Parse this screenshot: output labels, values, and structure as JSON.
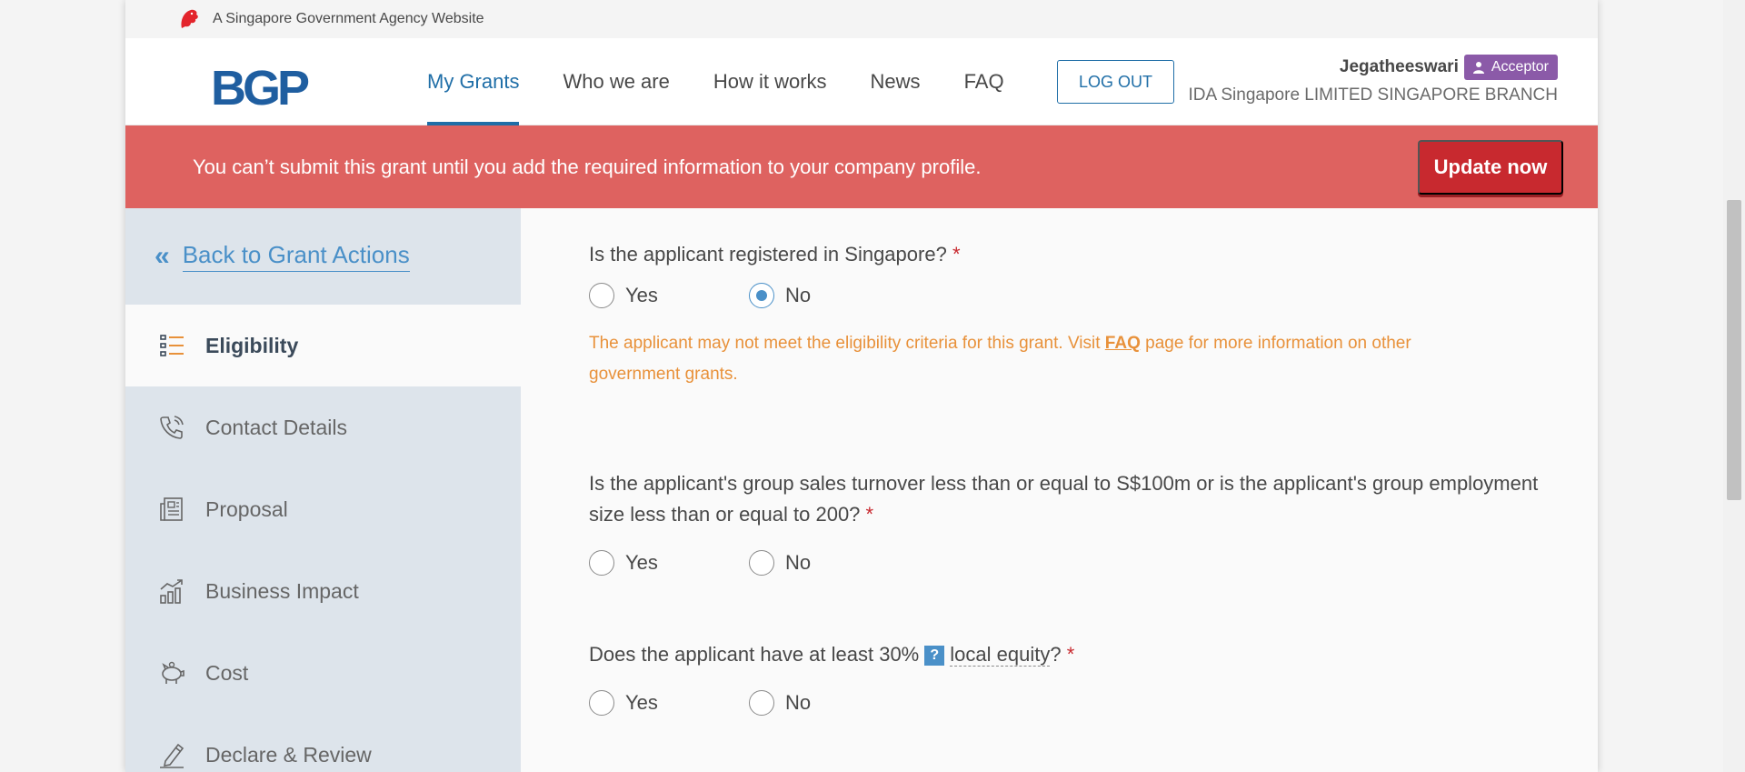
{
  "gov_bar": {
    "text": "A Singapore Government Agency Website"
  },
  "logo": {
    "text": "BGP"
  },
  "nav": {
    "items": [
      {
        "label": "My Grants",
        "active": true
      },
      {
        "label": "Who we are",
        "active": false
      },
      {
        "label": "How it works",
        "active": false
      },
      {
        "label": "News",
        "active": false
      },
      {
        "label": "FAQ",
        "active": false
      }
    ],
    "logout_label": "LOG OUT"
  },
  "user": {
    "name": "Jegatheeswari",
    "role": "Acceptor",
    "company": "IDA Singapore LIMITED SINGAPORE BRANCH"
  },
  "alert": {
    "message": "You can’t submit this grant until you add the required information to your company profile.",
    "button_label": "Update now"
  },
  "sidebar": {
    "back_label": "Back to Grant Actions",
    "items": [
      {
        "label": "Eligibility",
        "icon": "list-icon",
        "active": true
      },
      {
        "label": "Contact Details",
        "icon": "phone-icon",
        "active": false
      },
      {
        "label": "Proposal",
        "icon": "document-icon",
        "active": false
      },
      {
        "label": "Business Impact",
        "icon": "chart-icon",
        "active": false
      },
      {
        "label": "Cost",
        "icon": "piggy-bank-icon",
        "active": false
      },
      {
        "label": "Declare & Review",
        "icon": "pen-icon",
        "active": false
      }
    ]
  },
  "questions": [
    {
      "text": "Is the applicant registered in Singapore?",
      "required": "*",
      "options": [
        "Yes",
        "No"
      ],
      "selected": "No",
      "warning": {
        "before": "The applicant may not meet the eligibility criteria for this grant. Visit ",
        "link": "FAQ",
        "after": " page for more information on other government grants."
      }
    },
    {
      "text": "Is the applicant's group sales turnover less than or equal to S$100m or is the applicant's group employment size less than or equal to 200?",
      "required": "*",
      "options": [
        "Yes",
        "No"
      ],
      "selected": null
    },
    {
      "text_before": "Does the applicant have at least 30%",
      "tooltip": "?",
      "term": "local equity",
      "text_after": "?",
      "required": "*",
      "options": [
        "Yes",
        "No"
      ],
      "selected": null
    }
  ],
  "colors": {
    "primary": "#1f6ea7",
    "alert_bg": "#de6260",
    "danger": "#c8292f",
    "warning": "#e8913a",
    "badge": "#8b5aa8",
    "sidebar_bg": "#dde4eb"
  }
}
